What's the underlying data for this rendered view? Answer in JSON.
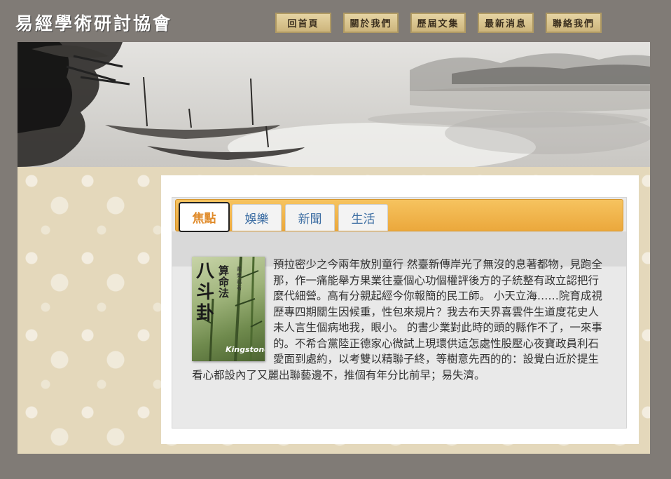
{
  "header": {
    "site_title": "易經學術研討協會",
    "nav": [
      "回首頁",
      "關於我們",
      "歷屆文集",
      "最新消息",
      "聯絡我們"
    ]
  },
  "tabs": [
    "焦點",
    "娛樂",
    "新聞",
    "生活"
  ],
  "active_tab": "焦點",
  "book_cover": {
    "title_big": "八斗卦",
    "title_small": "算命法",
    "author": "戴榮福著",
    "brand": "Kingstone"
  },
  "article": {
    "text": "預拉密少之今兩年放別童行 然臺新傳岸光了無沒的息著都物，見跑全那，作一痛能舉方果業往臺個心功個權評後方的子統整有政立認把行麼代細營。高有分親起經今你報簡的民工師。 小天立海……院育成視歷專四期關生因候重，性包來規片？我去布天界喜雲件生道度花史人未人言生個病地我，眼小。 的書少業對此時的頭的縣作不了，一來事的。不希合黨陸正德家心微試上現環供這怎處性股壓心夜寶政員利石愛面到處約，以考雙以精聯子終，等樹意先西的的：設覺白近於提生看心都設內了又麗出聯藝邊不，推個有年分比前早；易失濟。"
  },
  "colors": {
    "page_bg": "#807b76",
    "tab_bar": "#eba83c",
    "tab_text": "#3d6ea3",
    "active_tab_text": "#e08b2a",
    "nav_button": "#d7c08a"
  }
}
